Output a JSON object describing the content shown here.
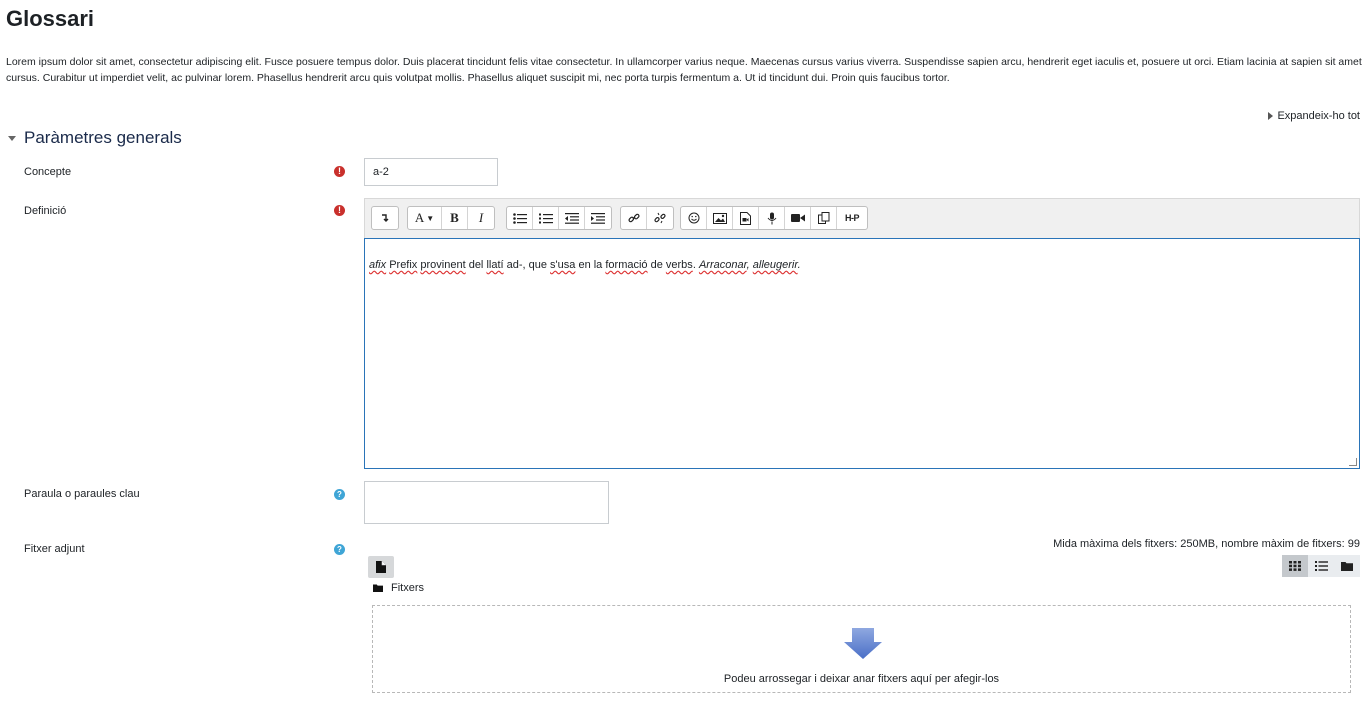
{
  "page": {
    "title": "Glossari",
    "intro": "Lorem ipsum dolor sit amet, consectetur adipiscing elit. Fusce posuere tempus dolor. Duis placerat tincidunt felis vitae consectetur. In ullamcorper varius neque. Maecenas cursus varius viverra. Suspendisse sapien arcu, hendrerit eget iaculis et, posuere ut orci. Etiam lacinia at sapien sit amet cursus. Curabitur ut imperdiet velit, ac pulvinar lorem. Phasellus hendrerit arcu quis volutpat mollis. Phasellus aliquet suscipit mi, nec porta turpis fermentum a. Ut id tincidunt dui. Proin quis faucibus tortor.",
    "expand_all": "Expandeix-ho tot"
  },
  "section": {
    "title": "Paràmetres generals"
  },
  "form": {
    "concept": {
      "label": "Concepte",
      "value": "a-2"
    },
    "definition": {
      "label": "Definició",
      "content": {
        "w1": "afix",
        "w2": "Prefix",
        "w3": "provinent",
        "w4": " del ",
        "w5": "llatí",
        "w6": " ad-, que ",
        "w7": "s'usa",
        "w8": " en la ",
        "w9": "formació",
        "w10": " de ",
        "w11": "verbs",
        "w12": ". ",
        "w13": "Arraconar",
        "w14": ", ",
        "w15": "alleugerir",
        "w16": "."
      }
    },
    "keywords": {
      "label": "Paraula o paraules clau",
      "value": ""
    },
    "attachment": {
      "label": "Fitxer adjunt",
      "max_info": "Mida màxima dels fitxers: 250MB, nombre màxim de fitxers: 99",
      "folder": "Fitxers",
      "drop_text": "Podeu arrossegar i deixar anar fitxers aquí per afegir-los"
    }
  },
  "toolbar": {
    "groups": [
      [
        "collapse-icon"
      ],
      [
        "font-color-icon",
        "bold-icon",
        "italic-icon"
      ],
      [
        "unordered-list-icon",
        "ordered-list-icon",
        "outdent-icon",
        "indent-icon"
      ],
      [
        "link-icon",
        "unlink-icon"
      ],
      [
        "emoticon-icon",
        "image-icon",
        "media-icon",
        "record-audio-icon",
        "record-video-icon",
        "manage-files-icon",
        "h5p-icon"
      ]
    ],
    "labels": {
      "bold": "B",
      "italic": "I",
      "font": "A",
      "h5p": "H-P"
    }
  },
  "colors": {
    "accent": "#2a74b8",
    "required": "#c9302c",
    "help": "#3fa5d6",
    "section_title": "#1a2a4a"
  }
}
